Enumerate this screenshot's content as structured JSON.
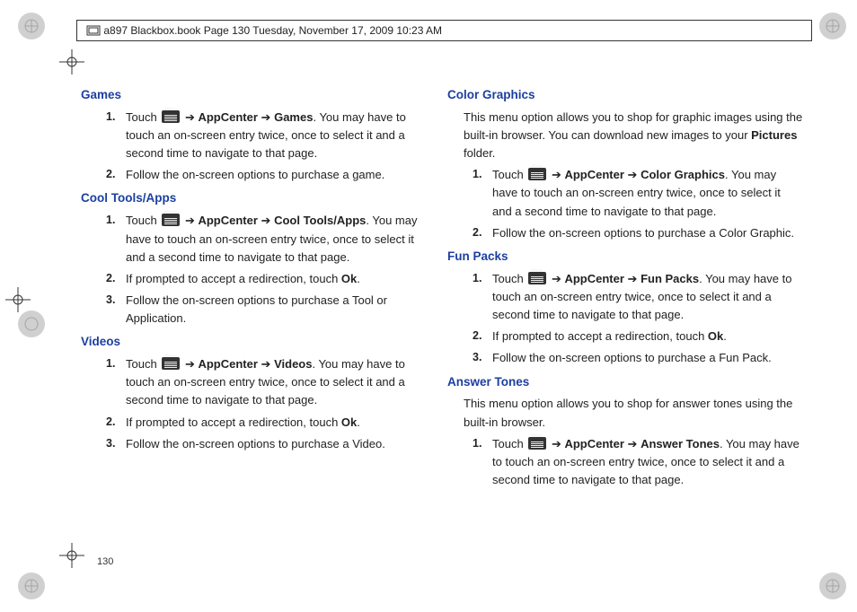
{
  "header": "a897 Blackbox.book  Page 130  Tuesday, November 17, 2009  10:23 AM",
  "page_number": "130",
  "arrow": "➔",
  "left_col": {
    "games": {
      "heading": "Games",
      "step1_a": "Touch ",
      "step1_nav1": "AppCenter",
      "step1_nav2": "Games",
      "step1_b": ". You may have to touch an on-screen entry twice, once to select it and a second time to navigate to that page.",
      "step2": "Follow the on-screen options to purchase a game."
    },
    "cooltools": {
      "heading": "Cool Tools/Apps",
      "step1_a": "Touch ",
      "step1_nav1": "AppCenter",
      "step1_nav2": "Cool Tools/Apps",
      "step1_b": ". You may have to touch an on-screen entry twice, once to select it and a second time to navigate to that page.",
      "step2_a": "If prompted to accept a redirection, touch ",
      "step2_ok": "Ok",
      "step2_b": ".",
      "step3": "Follow the on-screen options to purchase a Tool or Application."
    },
    "videos": {
      "heading": "Videos",
      "step1_a": "Touch ",
      "step1_nav1": "AppCenter",
      "step1_nav2": "Videos",
      "step1_b": ". You may have to touch an on-screen entry twice, once to select it and a second time to navigate to that page.",
      "step2_a": "If prompted to accept a redirection, touch ",
      "step2_ok": "Ok",
      "step2_b": ".",
      "step3": "Follow the on-screen options to purchase a Video."
    }
  },
  "right_col": {
    "colorg": {
      "heading": "Color Graphics",
      "intro_a": "This menu option allows you to shop for graphic images using the built-in browser. You can download new images to your ",
      "intro_bold": "Pictures",
      "intro_b": " folder.",
      "step1_a": "Touch ",
      "step1_nav1": "AppCenter",
      "step1_nav2": "Color Graphics",
      "step1_b": ". You may have to touch an on-screen entry twice, once to select it and a second time to navigate to that page.",
      "step2": "Follow the on-screen options to purchase a Color Graphic."
    },
    "funpacks": {
      "heading": "Fun Packs",
      "step1_a": "Touch ",
      "step1_nav1": "AppCenter",
      "step1_nav2": "Fun Packs",
      "step1_b": ". You may have to touch an on-screen entry twice, once to select it and a second time to navigate to that page.",
      "step2_a": "If prompted to accept a redirection, touch ",
      "step2_ok": "Ok",
      "step2_b": ".",
      "step3": "Follow the on-screen options to purchase a Fun Pack."
    },
    "answertones": {
      "heading": "Answer Tones",
      "intro": "This menu option allows you to shop for answer tones using the built-in browser.",
      "step1_a": "Touch ",
      "step1_nav1": "AppCenter",
      "step1_nav2": "Answer Tones",
      "step1_b": ". You may have to touch an on-screen entry twice, once to select it and a second time to navigate to that page."
    }
  },
  "nums": {
    "n1": "1.",
    "n2": "2.",
    "n3": "3."
  }
}
